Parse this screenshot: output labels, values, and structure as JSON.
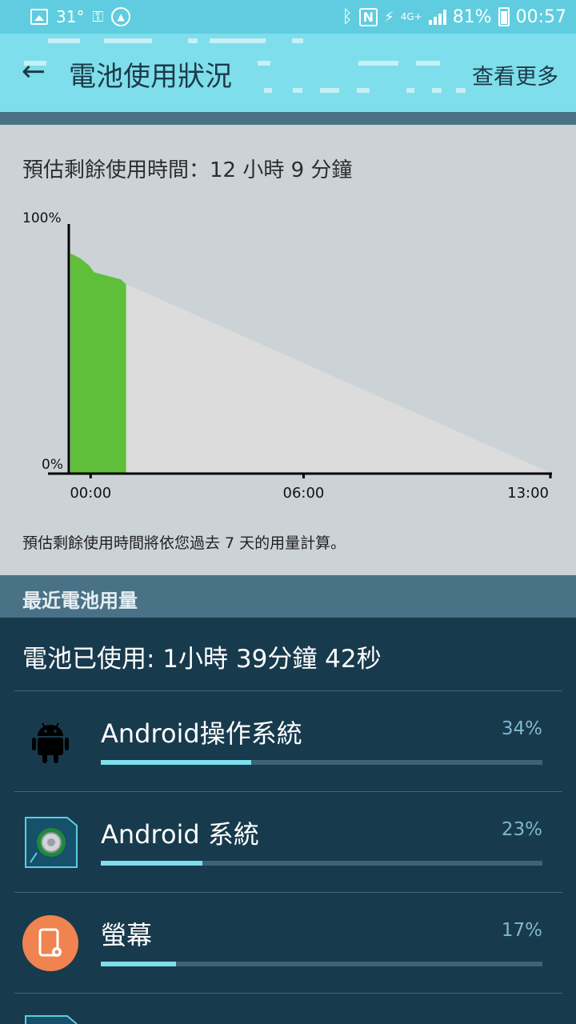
{
  "status_bar": {
    "temperature": "31°",
    "battery_percent": "81%",
    "time": "00:57",
    "network": "4G+",
    "icons": [
      "picture-icon",
      "key-icon",
      "compass-icon",
      "bluetooth-icon",
      "nfc-icon",
      "data-icon",
      "signal-icon",
      "battery-icon"
    ]
  },
  "app_bar": {
    "title": "電池使用狀況",
    "more_label": "查看更多"
  },
  "prediction": {
    "estimate_text": "預估剩餘使用時間：12 小時 9 分鐘",
    "note": "預估剩餘使用時間將依您過去 7 天的用量計算。"
  },
  "chart_data": {
    "type": "area",
    "y_axis_labels": [
      "100%",
      "0%"
    ],
    "x_axis_labels": [
      "00:00",
      "06:00",
      "13:00"
    ],
    "ylim": [
      0,
      100
    ],
    "xlim_hours": [
      -0.57,
      13.0
    ],
    "series": [
      {
        "name": "",
        "color": "#5fbf3a",
        "x": [
          -0.57,
          -0.3,
          -0.05,
          0.1,
          0.35,
          0.6,
          0.85,
          1.0
        ],
        "values": [
          93,
          91,
          88,
          85,
          84,
          83,
          82,
          80
        ]
      },
      {
        "name": "",
        "color": "#dcdcdc",
        "x": [
          1.0,
          13.0
        ],
        "values": [
          80,
          0
        ]
      }
    ]
  },
  "recent": {
    "header": "最近電池用量",
    "used_text": "電池已使用: 1小時 39分鐘 42秒",
    "items": [
      {
        "name": "Android操作系統",
        "percent_label": "34%",
        "percent": 34,
        "icon": "android-icon"
      },
      {
        "name": "Android 系統",
        "percent_label": "23%",
        "percent": 23,
        "icon": "android-system-icon"
      },
      {
        "name": "螢幕",
        "percent_label": "17%",
        "percent": 17,
        "icon": "screen-icon"
      }
    ]
  }
}
